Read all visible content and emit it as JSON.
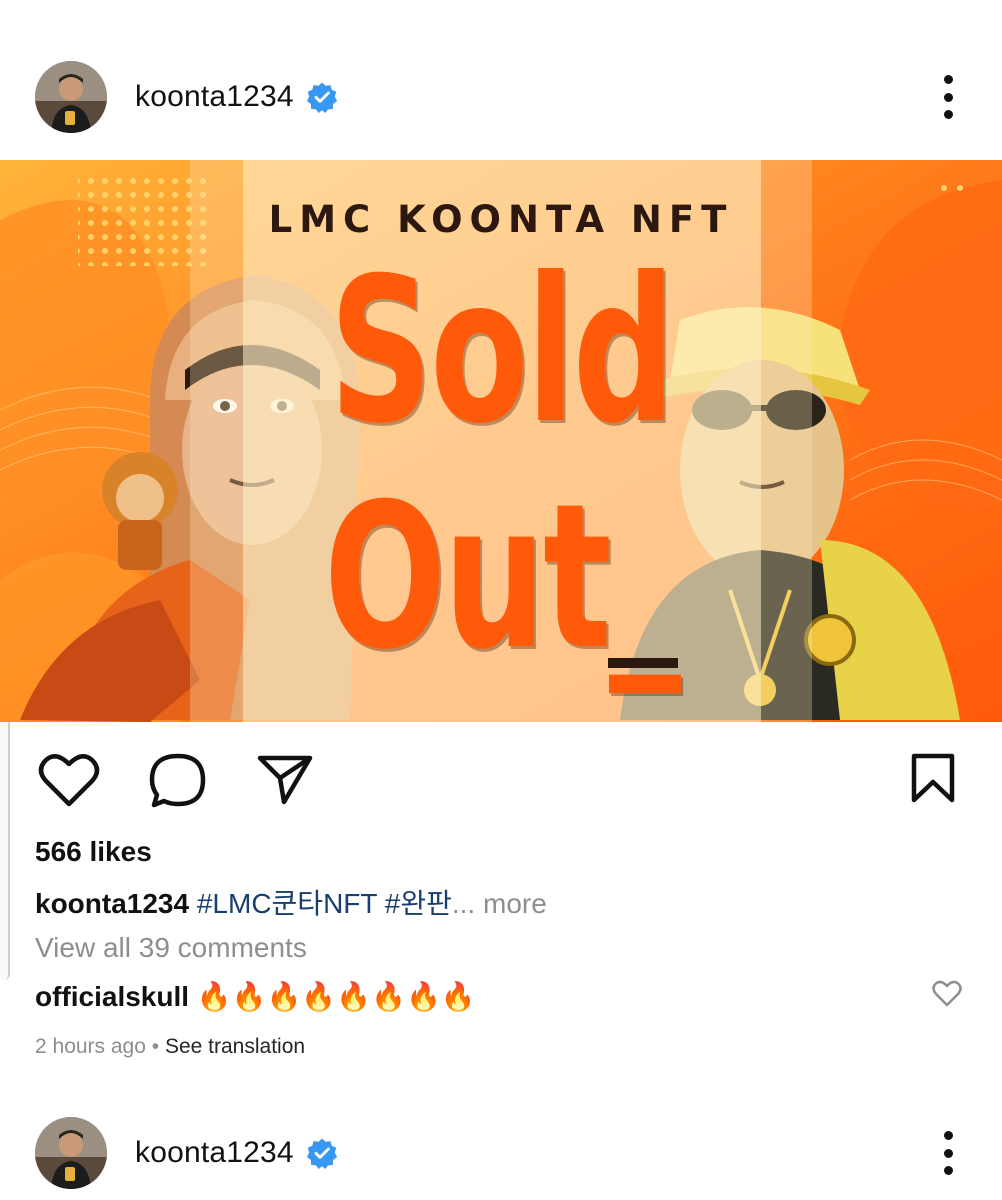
{
  "post": {
    "username": "koonta1234",
    "verified_icon": "verified-badge-icon",
    "image": {
      "title": "LMC KOONTA NFT",
      "line1": "Sold",
      "line2": "Out_"
    },
    "likes": "566 likes",
    "caption": {
      "username": "koonta1234",
      "hashtag1": "#LMC쿤타NFT",
      "hashtag2": "#완판",
      "more": "... more"
    },
    "view_comments": "View all 39 comments",
    "top_comment": {
      "username": "officialskull",
      "text": "🔥🔥🔥🔥🔥🔥🔥🔥"
    },
    "time": "2 hours ago",
    "separator": "•",
    "translate": "See translation"
  },
  "next_post": {
    "username": "koonta1234"
  },
  "colors": {
    "brand_orange": "#ff5a0a",
    "verified_blue": "#3897f0",
    "hashtag_blue": "#1a3f6e",
    "muted_gray": "#8e8e8e"
  }
}
